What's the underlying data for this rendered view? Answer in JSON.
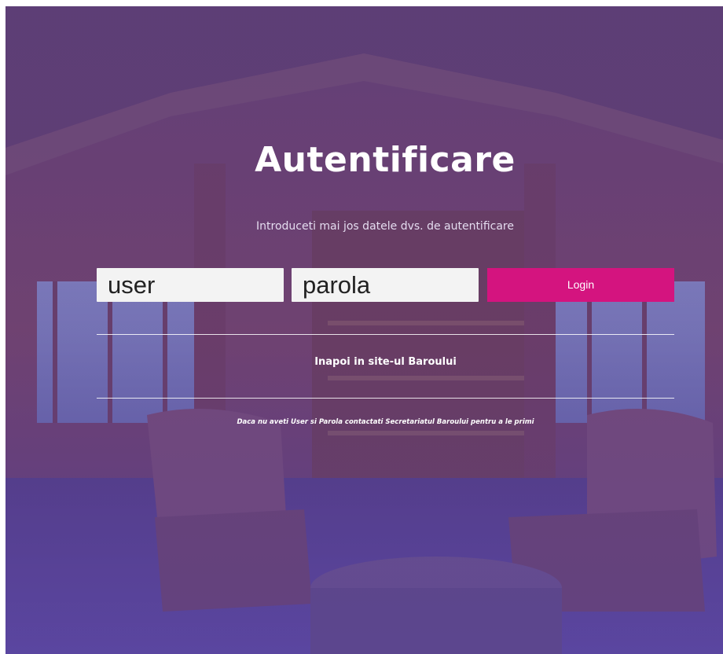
{
  "page": {
    "title": "Autentificare",
    "subtitle": "Introduceti mai jos datele dvs. de autentificare"
  },
  "form": {
    "user_value": "user",
    "password_value": "parola",
    "login_label": "Login"
  },
  "links": {
    "back_to_site": "Inapoi in site-ul Baroului"
  },
  "footer": {
    "note": "Daca nu aveti User si Parola contactati Secretariatul Baroului pentru a le primi"
  },
  "colors": {
    "overlay": "#5b3f85",
    "login_button": "#d4147f",
    "input_background": "#f3f3f3"
  }
}
